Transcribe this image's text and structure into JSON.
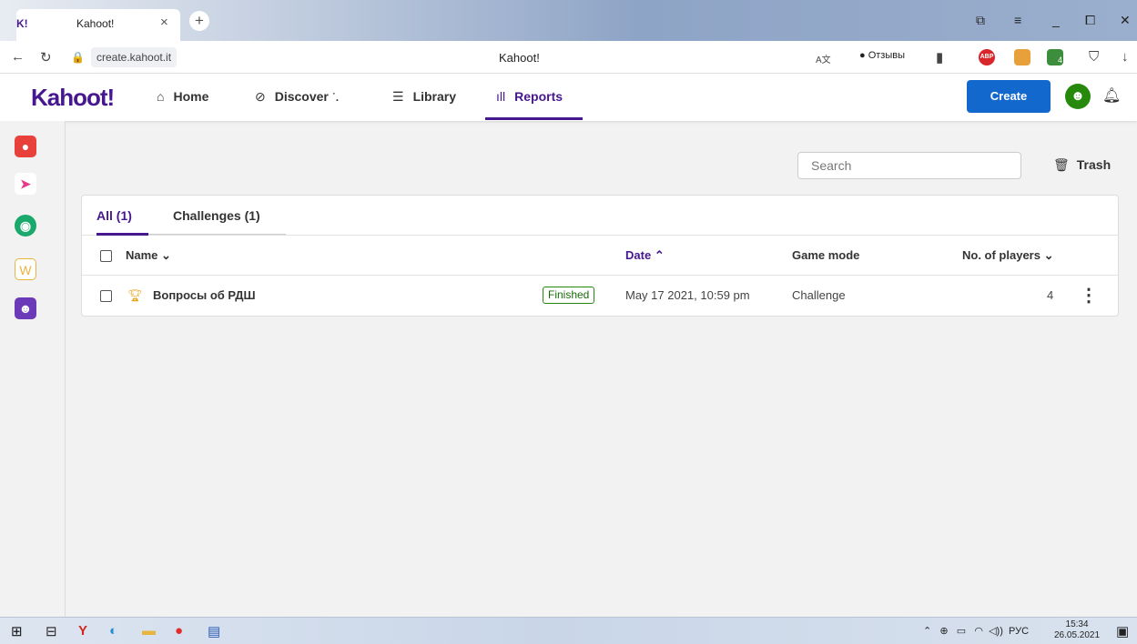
{
  "browser": {
    "tab_favicon": "K!",
    "tab_title": "Kahoot!",
    "tab_close": "×",
    "new_tab": "+",
    "url": "create.kahoot.it",
    "page_title": "Kahoot!",
    "translate_icon": "A文",
    "feedback_label": "Отзывы",
    "abp_label": "ABP",
    "ext_badge": "4"
  },
  "app": {
    "logo": "Kahoot!",
    "nav": [
      {
        "label": "Home",
        "icon": "home-icon",
        "glyph": "⌂"
      },
      {
        "label": "Discover",
        "icon": "compass-icon",
        "glyph": "⊘"
      },
      {
        "label": "Library",
        "icon": "list-icon",
        "glyph": "☰"
      },
      {
        "label": "Reports",
        "icon": "chart-icon",
        "glyph": "ıll"
      }
    ],
    "create_label": "Create",
    "accent": "#46178f",
    "create_color": "#1368ce"
  },
  "reports": {
    "search_placeholder": "Search",
    "trash_label": "Trash",
    "tabs": [
      {
        "label": "All (1)",
        "active": true
      },
      {
        "label": "Challenges (1)",
        "active": false
      }
    ],
    "columns": {
      "name": "Name",
      "date": "Date",
      "mode": "Game mode",
      "players": "No. of players"
    },
    "rows": [
      {
        "name": "Вопросы об РДШ",
        "status": "Finished",
        "date": "May 17 2021, 10:59 pm",
        "mode": "Challenge",
        "players": "4"
      }
    ]
  },
  "taskbar": {
    "lang": "РУС",
    "time": "15:34",
    "date": "26.05.2021"
  }
}
